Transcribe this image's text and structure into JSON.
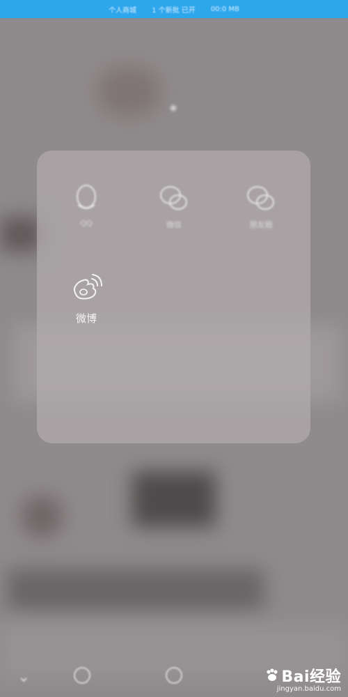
{
  "status_bar": {
    "left": "个人商城",
    "middle": "1 个新批 已开",
    "right": "00:0 MB"
  },
  "share_panel": {
    "targets": [
      {
        "label": "QQ",
        "icon": "qq-icon"
      },
      {
        "label": "微信",
        "icon": "wechat-icon"
      },
      {
        "label": "朋友圈",
        "icon": "moments-icon"
      },
      {
        "label": "微博",
        "icon": "weibo-icon"
      }
    ]
  },
  "nav_bar": {
    "icons": [
      "back-icon",
      "home-icon",
      "recents-icon"
    ]
  },
  "watermark": {
    "brand": "Bai经验",
    "url": "jingyan.baidu.com"
  },
  "colors": {
    "status_bar": "#2ea6ec",
    "background": "#8f8a8b",
    "panel": "#b2acae",
    "icon": "#e6e4e5"
  }
}
